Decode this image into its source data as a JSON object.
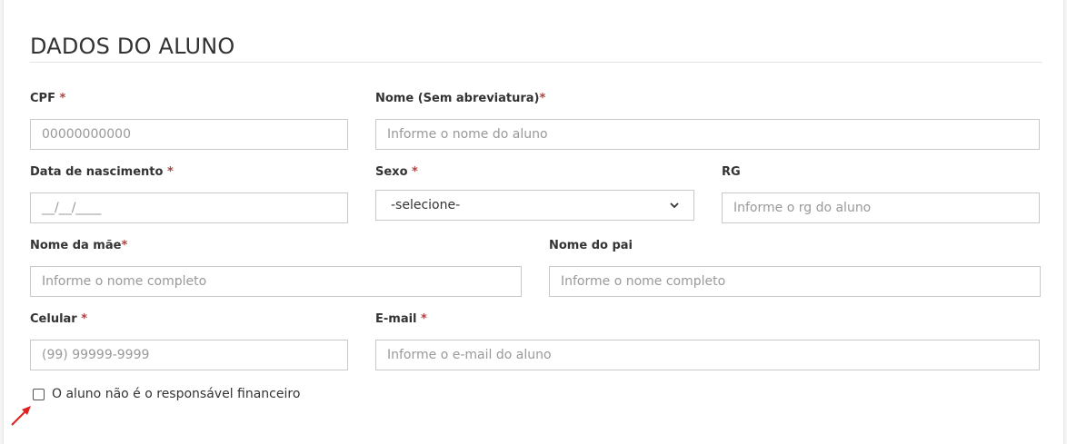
{
  "section": {
    "title": "DADOS DO ALUNO"
  },
  "fields": {
    "cpf": {
      "label": "CPF",
      "required": "*",
      "placeholder": "00000000000"
    },
    "nome": {
      "label": "Nome (Sem abreviatura)",
      "required": "*",
      "placeholder": "Informe o nome do aluno"
    },
    "nascimento": {
      "label": "Data de nascimento",
      "required": "*",
      "placeholder": "__/__/____"
    },
    "sexo": {
      "label": "Sexo",
      "required": "*",
      "selected": "-selecione-"
    },
    "rg": {
      "label": "RG",
      "placeholder": "Informe o rg do aluno"
    },
    "mae": {
      "label": "Nome da mãe",
      "required": "*",
      "placeholder": "Informe o nome completo"
    },
    "pai": {
      "label": "Nome do pai",
      "placeholder": "Informe o nome completo"
    },
    "celular": {
      "label": "Celular",
      "required": "*",
      "placeholder": "(99) 99999-9999"
    },
    "email": {
      "label": "E-mail",
      "required": "*",
      "placeholder": "Informe o e-mail do aluno"
    }
  },
  "checkbox": {
    "label": "O aluno não é o responsável financeiro",
    "checked": false
  },
  "colors": {
    "required": "#a94442",
    "annotation_arrow": "#e02020"
  },
  "icons": {
    "select_chevron": "chevron-down-icon",
    "annotation": "red-arrow-icon"
  }
}
